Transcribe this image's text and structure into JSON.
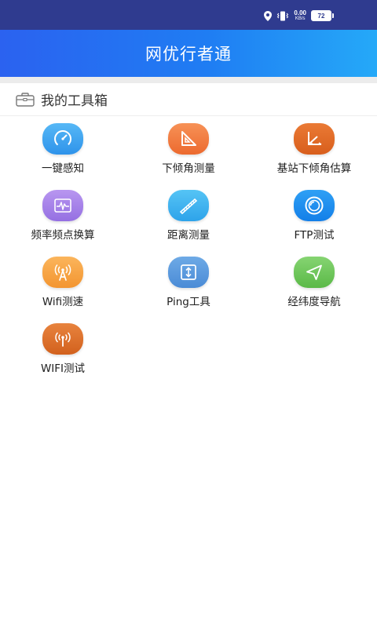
{
  "status_bar": {
    "net_speed_value": "0.00",
    "net_speed_unit": "KB/s",
    "battery": "72",
    "icons": [
      "location-icon",
      "vibrate-icon",
      "battery-icon"
    ]
  },
  "header": {
    "title": "网优行者通"
  },
  "section": {
    "title": "我的工具箱",
    "icon": "toolbox-icon"
  },
  "tools": [
    {
      "label": "一键感知",
      "icon": "speedometer-icon",
      "color": "#3aa3ee"
    },
    {
      "label": "下倾角测量",
      "icon": "triangle-ruler-icon",
      "color": "#f07a3e"
    },
    {
      "label": "基站下倾角估算",
      "icon": "angle-icon",
      "color": "#e06a26"
    },
    {
      "label": "频率频点换算",
      "icon": "waveform-icon",
      "color": "#a47ce6"
    },
    {
      "label": "距离测量",
      "icon": "ruler-icon",
      "color": "#3bb2ef"
    },
    {
      "label": "FTP测试",
      "icon": "disc-icon",
      "color": "#1a8ff0"
    },
    {
      "label": "Wifi测速",
      "icon": "antenna-icon",
      "color": "#f7a443"
    },
    {
      "label": "Ping工具",
      "icon": "upload-download-icon",
      "color": "#5c9ce0"
    },
    {
      "label": "经纬度导航",
      "icon": "navigation-arrow-icon",
      "color": "#6cc65a"
    },
    {
      "label": "WIFI测试",
      "icon": "wifi-tower-icon",
      "color": "#de6e2a"
    }
  ]
}
